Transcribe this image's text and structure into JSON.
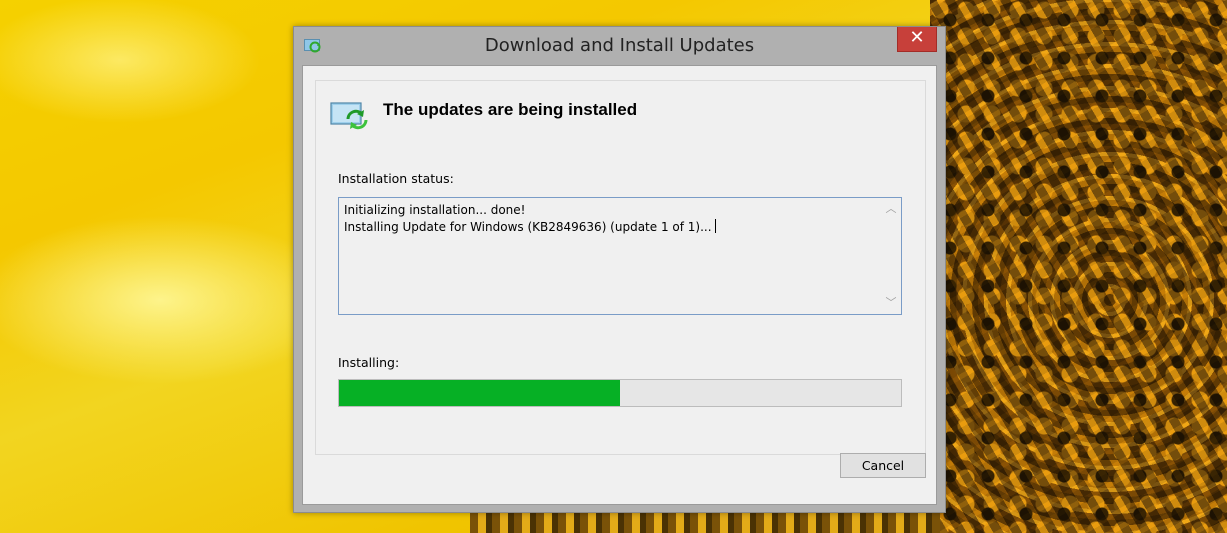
{
  "window": {
    "title": "Download and Install Updates",
    "icon": "windows-update-icon",
    "close_glyph": "✕"
  },
  "content": {
    "heading": "The updates are being installed",
    "heading_icon": "update-arrows-icon",
    "status_label": "Installation status:",
    "log_lines": [
      "Initializing installation... done!",
      "Installing Update for Windows (KB2849636) (update 1 of 1)..."
    ],
    "installing_label": "Installing:",
    "progress_fraction": 0.5,
    "progress_color": "#06b025"
  },
  "buttons": {
    "cancel_label": "Cancel"
  }
}
